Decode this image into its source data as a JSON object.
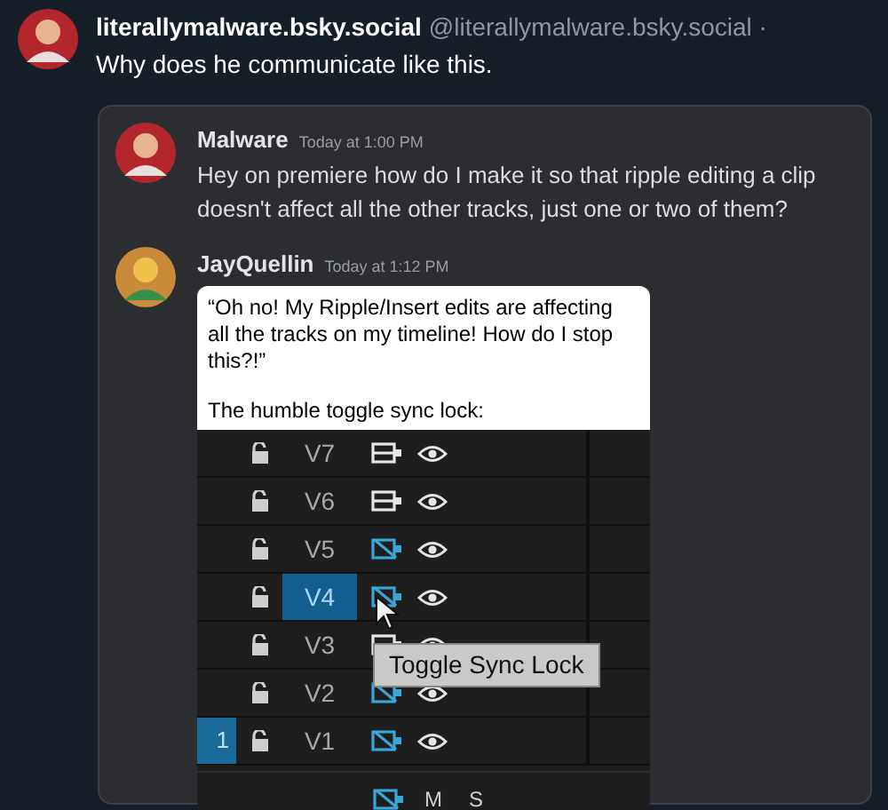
{
  "post": {
    "author": "literallymalware.bsky.social",
    "handle": "@literallymalware.bsky.social ·",
    "text": "Why does he communicate like this."
  },
  "messages": [
    {
      "kind": "text",
      "author": "Malware",
      "time": "Today at 1:00 PM",
      "text": "Hey on premiere how do I make it so that ripple editing a clip doesn't affect all the other tracks, just one or two of them?"
    },
    {
      "kind": "image",
      "author": "JayQuellin",
      "time": "Today at 1:12 PM",
      "caption": [
        "“Oh no! My Ripple/Insert edits are affecting all the tracks on my timeline! How do I stop this?!”",
        "The humble toggle sync lock:"
      ],
      "tracks": [
        {
          "label": "V7",
          "sync_lock": false,
          "selected": false
        },
        {
          "label": "V6",
          "sync_lock": false,
          "selected": false
        },
        {
          "label": "V5",
          "sync_lock": true,
          "selected": false
        },
        {
          "label": "V4",
          "sync_lock": true,
          "selected": true
        },
        {
          "label": "V3",
          "sync_lock": false,
          "selected": false
        },
        {
          "label": "V2",
          "sync_lock": true,
          "selected": false
        },
        {
          "label": "V1",
          "sync_lock": true,
          "selected": false,
          "source_patch": "1"
        }
      ],
      "audio_buttons": [
        "M",
        "S"
      ],
      "tooltip": "Toggle Sync Lock"
    }
  ]
}
